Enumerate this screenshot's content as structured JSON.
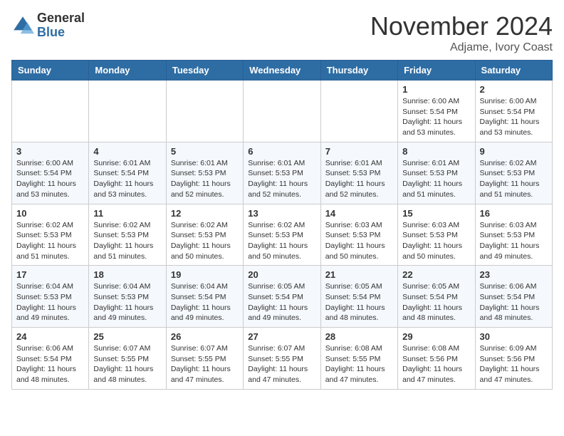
{
  "header": {
    "logo_general": "General",
    "logo_blue": "Blue",
    "month_title": "November 2024",
    "location": "Adjame, Ivory Coast"
  },
  "weekdays": [
    "Sunday",
    "Monday",
    "Tuesday",
    "Wednesday",
    "Thursday",
    "Friday",
    "Saturday"
  ],
  "weeks": [
    [
      {
        "day": "",
        "info": ""
      },
      {
        "day": "",
        "info": ""
      },
      {
        "day": "",
        "info": ""
      },
      {
        "day": "",
        "info": ""
      },
      {
        "day": "",
        "info": ""
      },
      {
        "day": "1",
        "info": "Sunrise: 6:00 AM\nSunset: 5:54 PM\nDaylight: 11 hours\nand 53 minutes."
      },
      {
        "day": "2",
        "info": "Sunrise: 6:00 AM\nSunset: 5:54 PM\nDaylight: 11 hours\nand 53 minutes."
      }
    ],
    [
      {
        "day": "3",
        "info": "Sunrise: 6:00 AM\nSunset: 5:54 PM\nDaylight: 11 hours\nand 53 minutes."
      },
      {
        "day": "4",
        "info": "Sunrise: 6:01 AM\nSunset: 5:54 PM\nDaylight: 11 hours\nand 53 minutes."
      },
      {
        "day": "5",
        "info": "Sunrise: 6:01 AM\nSunset: 5:53 PM\nDaylight: 11 hours\nand 52 minutes."
      },
      {
        "day": "6",
        "info": "Sunrise: 6:01 AM\nSunset: 5:53 PM\nDaylight: 11 hours\nand 52 minutes."
      },
      {
        "day": "7",
        "info": "Sunrise: 6:01 AM\nSunset: 5:53 PM\nDaylight: 11 hours\nand 52 minutes."
      },
      {
        "day": "8",
        "info": "Sunrise: 6:01 AM\nSunset: 5:53 PM\nDaylight: 11 hours\nand 51 minutes."
      },
      {
        "day": "9",
        "info": "Sunrise: 6:02 AM\nSunset: 5:53 PM\nDaylight: 11 hours\nand 51 minutes."
      }
    ],
    [
      {
        "day": "10",
        "info": "Sunrise: 6:02 AM\nSunset: 5:53 PM\nDaylight: 11 hours\nand 51 minutes."
      },
      {
        "day": "11",
        "info": "Sunrise: 6:02 AM\nSunset: 5:53 PM\nDaylight: 11 hours\nand 51 minutes."
      },
      {
        "day": "12",
        "info": "Sunrise: 6:02 AM\nSunset: 5:53 PM\nDaylight: 11 hours\nand 50 minutes."
      },
      {
        "day": "13",
        "info": "Sunrise: 6:02 AM\nSunset: 5:53 PM\nDaylight: 11 hours\nand 50 minutes."
      },
      {
        "day": "14",
        "info": "Sunrise: 6:03 AM\nSunset: 5:53 PM\nDaylight: 11 hours\nand 50 minutes."
      },
      {
        "day": "15",
        "info": "Sunrise: 6:03 AM\nSunset: 5:53 PM\nDaylight: 11 hours\nand 50 minutes."
      },
      {
        "day": "16",
        "info": "Sunrise: 6:03 AM\nSunset: 5:53 PM\nDaylight: 11 hours\nand 49 minutes."
      }
    ],
    [
      {
        "day": "17",
        "info": "Sunrise: 6:04 AM\nSunset: 5:53 PM\nDaylight: 11 hours\nand 49 minutes."
      },
      {
        "day": "18",
        "info": "Sunrise: 6:04 AM\nSunset: 5:53 PM\nDaylight: 11 hours\nand 49 minutes."
      },
      {
        "day": "19",
        "info": "Sunrise: 6:04 AM\nSunset: 5:54 PM\nDaylight: 11 hours\nand 49 minutes."
      },
      {
        "day": "20",
        "info": "Sunrise: 6:05 AM\nSunset: 5:54 PM\nDaylight: 11 hours\nand 49 minutes."
      },
      {
        "day": "21",
        "info": "Sunrise: 6:05 AM\nSunset: 5:54 PM\nDaylight: 11 hours\nand 48 minutes."
      },
      {
        "day": "22",
        "info": "Sunrise: 6:05 AM\nSunset: 5:54 PM\nDaylight: 11 hours\nand 48 minutes."
      },
      {
        "day": "23",
        "info": "Sunrise: 6:06 AM\nSunset: 5:54 PM\nDaylight: 11 hours\nand 48 minutes."
      }
    ],
    [
      {
        "day": "24",
        "info": "Sunrise: 6:06 AM\nSunset: 5:54 PM\nDaylight: 11 hours\nand 48 minutes."
      },
      {
        "day": "25",
        "info": "Sunrise: 6:07 AM\nSunset: 5:55 PM\nDaylight: 11 hours\nand 48 minutes."
      },
      {
        "day": "26",
        "info": "Sunrise: 6:07 AM\nSunset: 5:55 PM\nDaylight: 11 hours\nand 47 minutes."
      },
      {
        "day": "27",
        "info": "Sunrise: 6:07 AM\nSunset: 5:55 PM\nDaylight: 11 hours\nand 47 minutes."
      },
      {
        "day": "28",
        "info": "Sunrise: 6:08 AM\nSunset: 5:55 PM\nDaylight: 11 hours\nand 47 minutes."
      },
      {
        "day": "29",
        "info": "Sunrise: 6:08 AM\nSunset: 5:56 PM\nDaylight: 11 hours\nand 47 minutes."
      },
      {
        "day": "30",
        "info": "Sunrise: 6:09 AM\nSunset: 5:56 PM\nDaylight: 11 hours\nand 47 minutes."
      }
    ]
  ]
}
